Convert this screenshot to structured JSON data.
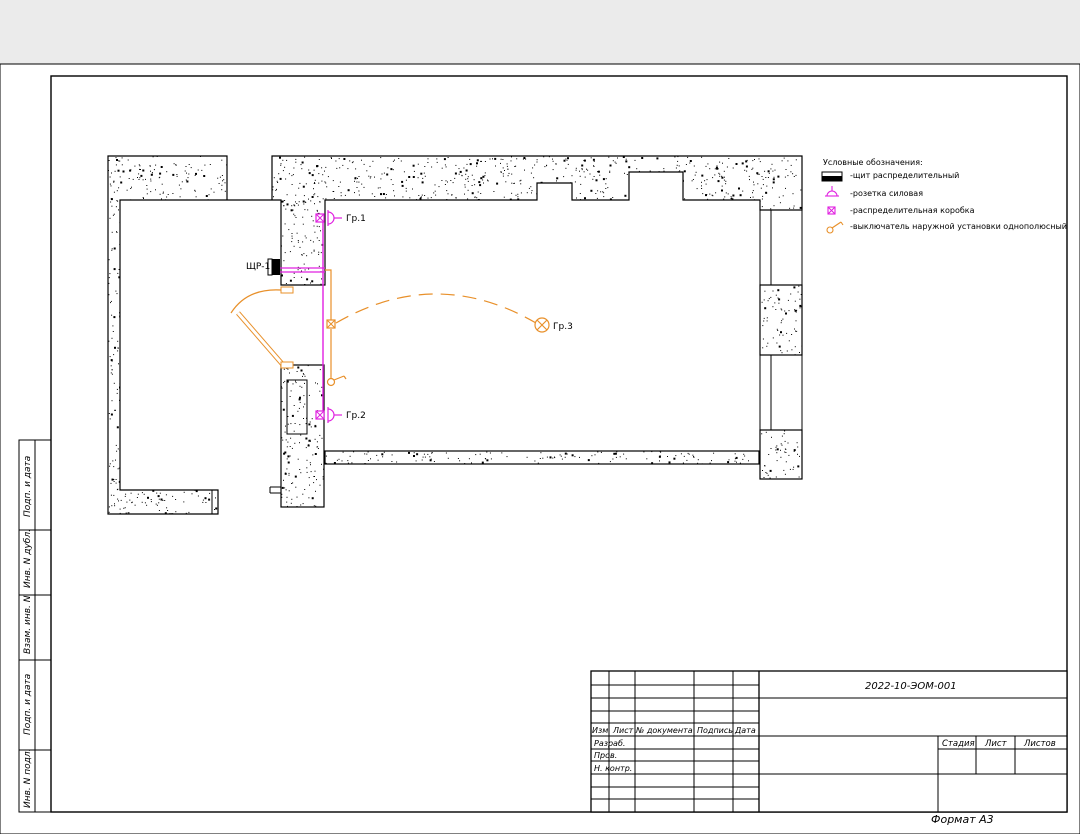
{
  "sheet": {
    "format_label": "Формат А3"
  },
  "side_stamp": {
    "labels": [
      "Подп. и дата",
      "Инв. N дубл.",
      "Взам. инв. N",
      "Подп. и дата",
      "Инв. N подл."
    ]
  },
  "plan": {
    "panel_label": "ЩР-1",
    "group_labels": {
      "gr1": "Гр.1",
      "gr2": "Гр.2",
      "gr3": "Гр.3"
    }
  },
  "legend": {
    "title": "Условные обозначения:",
    "items": [
      {
        "label": "-щит распределительный",
        "icon": "panel-icon"
      },
      {
        "label": "-розетка силовая",
        "icon": "socket-icon"
      },
      {
        "label": "-распределительная коробка",
        "icon": "junction-box-icon"
      },
      {
        "label": "-выключатель наружной установки однополюсный",
        "icon": "switch-icon"
      }
    ]
  },
  "title_block": {
    "doc_code": "2022-10-ЭОМ-001",
    "col_headers": [
      "Изм",
      "Лист",
      "№ документа",
      "Подпись",
      "Дата"
    ],
    "row_labels": [
      "Разраб.",
      "Пров.",
      "Н. контр."
    ],
    "stage_headers": [
      "Стадия",
      "Лист",
      "Листов"
    ]
  },
  "colors": {
    "wiring_magenta": "#e020e0",
    "wiring_orange": "#e8902a",
    "wall_fill": "#ffffff",
    "ink": "#000000"
  }
}
